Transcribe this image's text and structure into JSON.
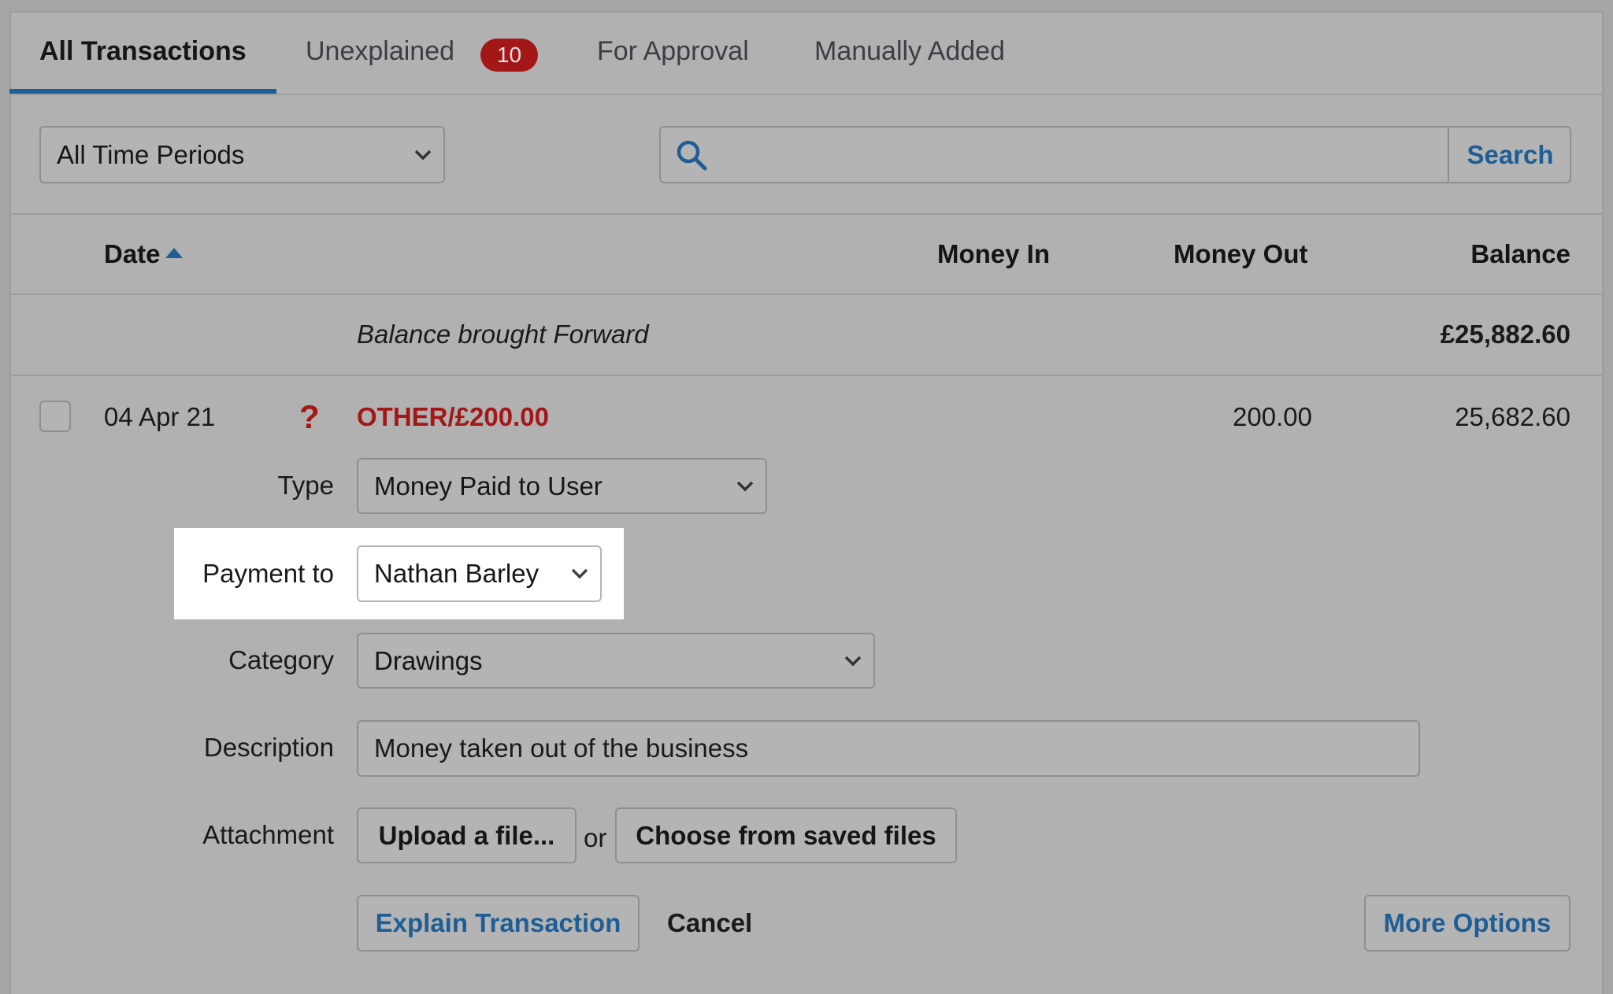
{
  "tabs": [
    {
      "label": "All Transactions",
      "active": true
    },
    {
      "label": "Unexplained",
      "badge": "10"
    },
    {
      "label": "For Approval"
    },
    {
      "label": "Manually Added"
    }
  ],
  "filters": {
    "period": "All Time Periods",
    "search_placeholder": "",
    "search_button": "Search"
  },
  "columns": {
    "date": "Date",
    "money_in": "Money In",
    "money_out": "Money Out",
    "balance": "Balance"
  },
  "brought_forward": {
    "label": "Balance brought Forward",
    "amount": "£25,882.60"
  },
  "transaction": {
    "date": "04 Apr 21",
    "status_icon": "question-mark",
    "description": "OTHER/£200.00",
    "money_out": "200.00",
    "balance": "25,682.60"
  },
  "form": {
    "type_label": "Type",
    "type_value": "Money Paid to User",
    "payment_to_label": "Payment to",
    "payment_to_value": "Nathan Barley",
    "category_label": "Category",
    "category_value": "Drawings",
    "description_label": "Description",
    "description_value": "Money taken out of the business",
    "attachment_label": "Attachment",
    "upload_button": "Upload a file...",
    "or_text": "or",
    "choose_saved_button": "Choose from saved files",
    "explain_button": "Explain Transaction",
    "cancel_link": "Cancel",
    "more_options_button": "More Options"
  },
  "colors": {
    "accent": "#1f5e95",
    "badge": "#a31717",
    "negative": "#a31717"
  }
}
